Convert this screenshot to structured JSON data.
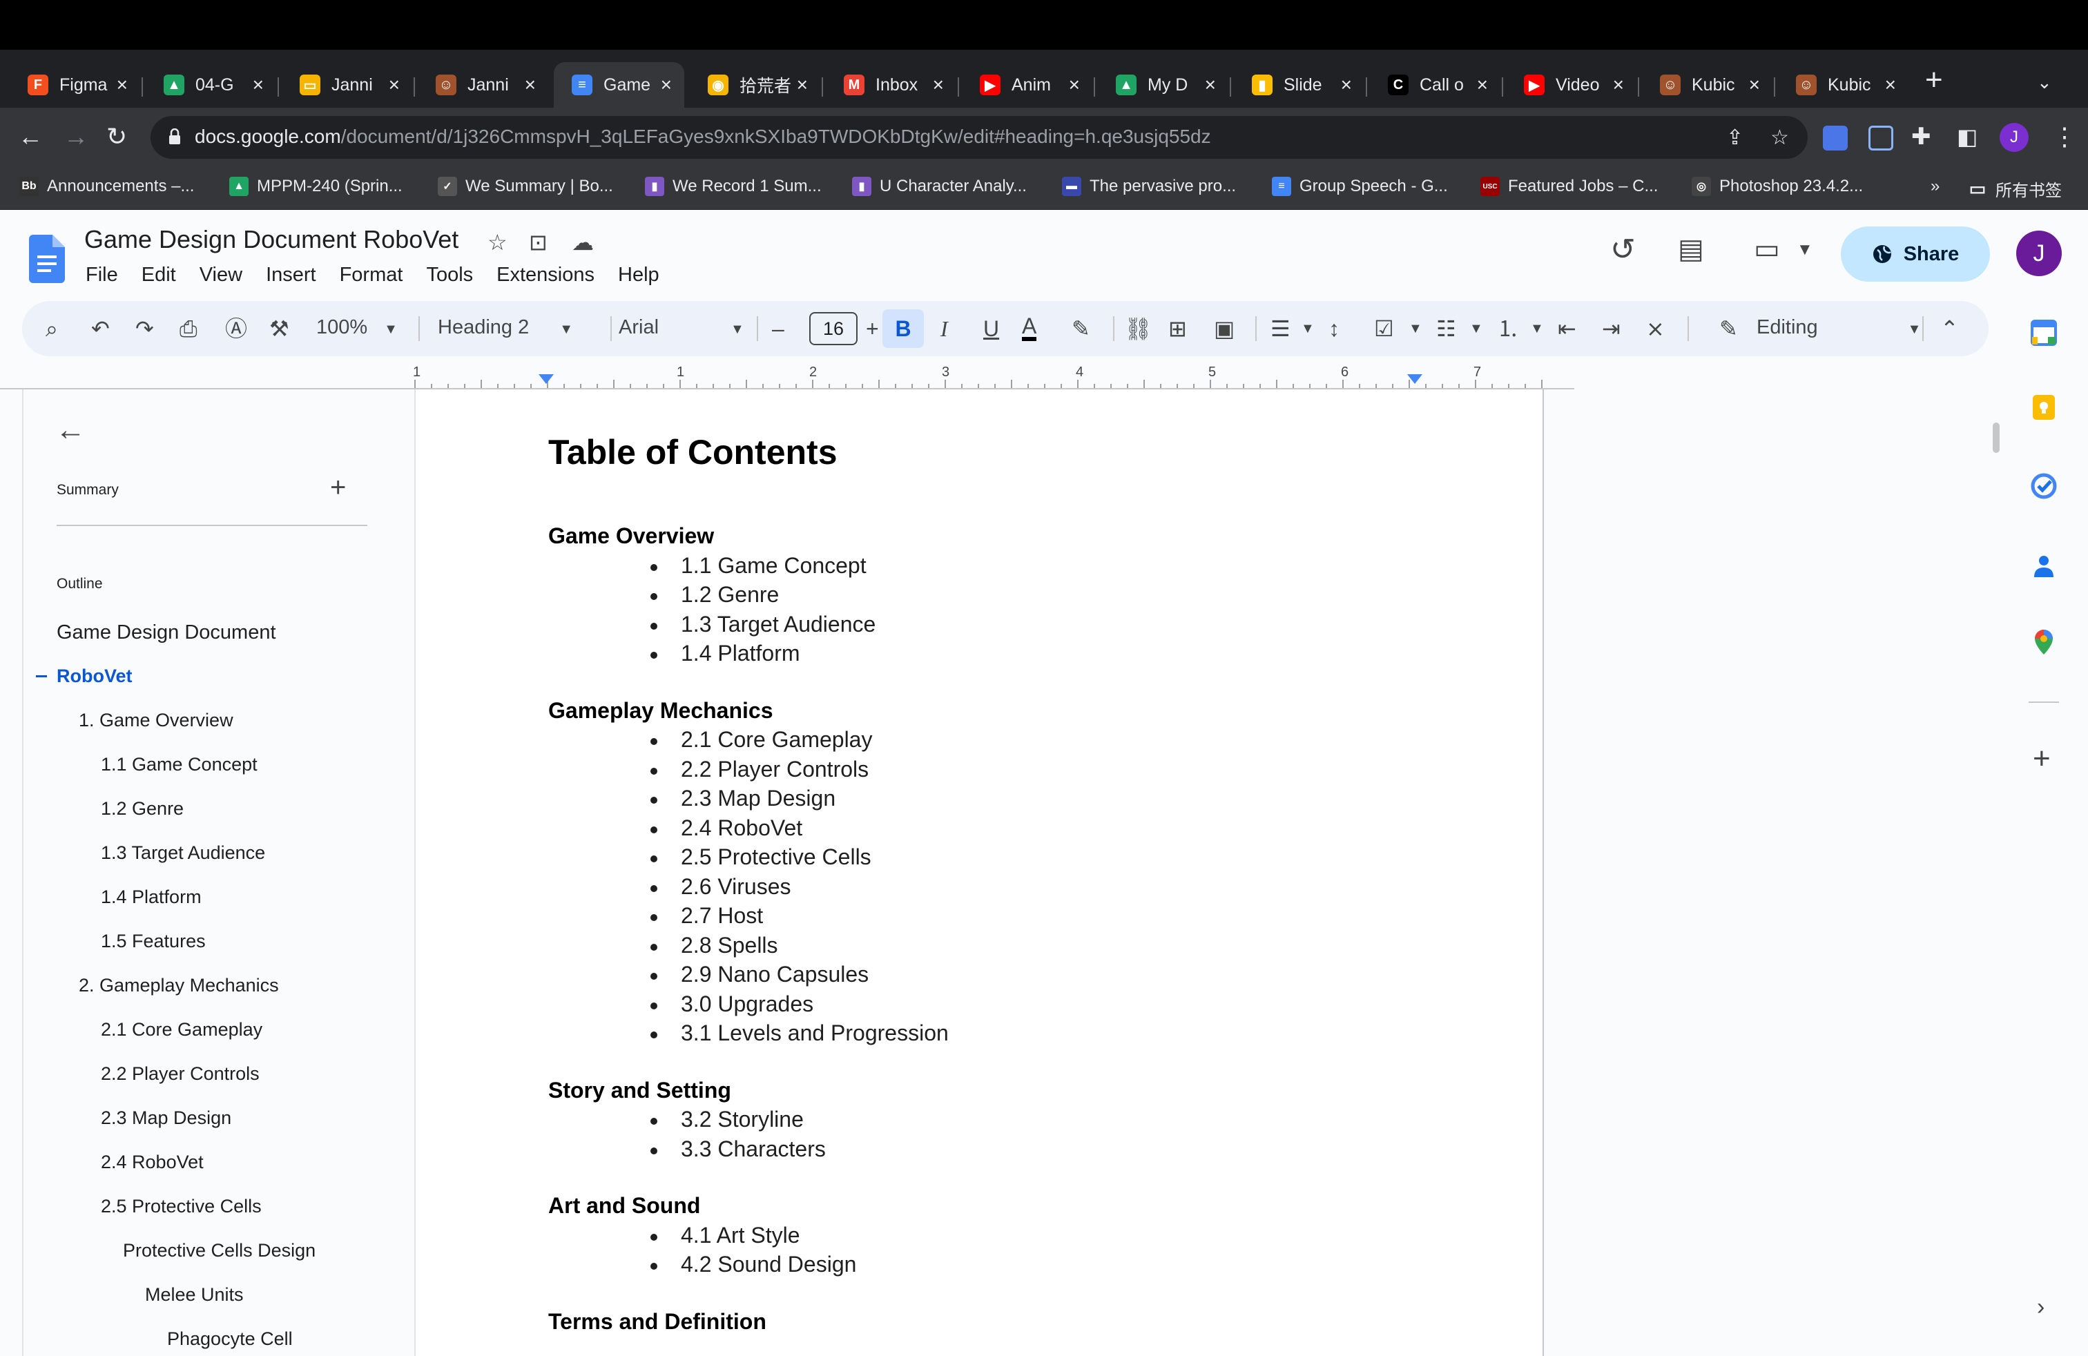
{
  "browser": {
    "tabs": [
      {
        "title": "Figma",
        "favicon": "figma-icon",
        "color": "#f24e1e",
        "glyph": "F"
      },
      {
        "title": "04-G",
        "favicon": "drive-icon",
        "color": "#1fa463",
        "glyph": "▲"
      },
      {
        "title": "Janni",
        "favicon": "slides-icon",
        "color": "#f4b400",
        "glyph": "▭"
      },
      {
        "title": "Janni",
        "favicon": "avatar-icon",
        "color": "#a0522d",
        "glyph": "☺"
      },
      {
        "title": "Game",
        "favicon": "docs-icon",
        "color": "#4285f4",
        "glyph": "≡"
      },
      {
        "title": "拾荒者",
        "favicon": "coin-icon",
        "color": "#f4b400",
        "glyph": "◉"
      },
      {
        "title": "Inbox",
        "favicon": "gmail-icon",
        "color": "#ea4335",
        "glyph": "M"
      },
      {
        "title": "Anim",
        "favicon": "youtube-icon",
        "color": "#ff0000",
        "glyph": "▶"
      },
      {
        "title": "My D",
        "favicon": "drive-icon",
        "color": "#1fa463",
        "glyph": "▲"
      },
      {
        "title": "Slide",
        "favicon": "chart-icon",
        "color": "#fbbc04",
        "glyph": "▮"
      },
      {
        "title": "Call o",
        "favicon": "c-icon",
        "color": "#000000",
        "glyph": "C"
      },
      {
        "title": "Video",
        "favicon": "youtube-icon",
        "color": "#ff0000",
        "glyph": "▶"
      },
      {
        "title": "Kubic",
        "favicon": "avatar-icon",
        "color": "#a0522d",
        "glyph": "☺"
      },
      {
        "title": "Kubic",
        "favicon": "avatar-icon",
        "color": "#a0522d",
        "glyph": "☺"
      }
    ],
    "active_tab_index": 4,
    "url_host": "docs.google.com",
    "url_path": "/document/d/1j326CmmspvH_3qLEFaGyes9xnkSXIba9TWDOKbDtgKw/edit#heading=h.qe3usjq55dz",
    "profile_initial": "J",
    "bookmarks": [
      {
        "label": "Announcements –...",
        "icon": "Bb",
        "color": "#333333"
      },
      {
        "label": "MPPM-240 (Sprin...",
        "icon": "▲",
        "color": "#1fa463"
      },
      {
        "label": "We Summary | Bo...",
        "icon": "✓",
        "color": "#555555"
      },
      {
        "label": "We Record 1 Sum...",
        "icon": "▮",
        "color": "#7e57c2"
      },
      {
        "label": "U Character Analy...",
        "icon": "▮",
        "color": "#7e57c2"
      },
      {
        "label": "The pervasive pro...",
        "icon": "▬",
        "color": "#3949ab"
      },
      {
        "label": "Group Speech - G...",
        "icon": "≡",
        "color": "#4285f4"
      },
      {
        "label": "Featured Jobs – C...",
        "icon": "USC",
        "color": "#990000"
      },
      {
        "label": "Photoshop 23.4.2...",
        "icon": "◎",
        "color": "#444444"
      }
    ],
    "bookmarks_more": "»",
    "all_bookmarks": "所有书签"
  },
  "docs": {
    "title": "Game Design Document RoboVet",
    "menu": [
      "File",
      "Edit",
      "View",
      "Insert",
      "Format",
      "Tools",
      "Extensions",
      "Help"
    ],
    "share_label": "Share",
    "account_initial": "J",
    "toolbar": {
      "zoom": "100%",
      "style": "Heading 2",
      "font": "Arial",
      "font_size": "16",
      "bold": "B",
      "italic": "I",
      "underline": "U",
      "text_color": "A",
      "mode": "Editing"
    },
    "ruler_numbers": [
      "1",
      "1",
      "2",
      "3",
      "4",
      "5",
      "6",
      "7"
    ],
    "accent_color": "#0b57d0"
  },
  "outline": {
    "summary_label": "Summary",
    "outline_label": "Outline",
    "items": [
      {
        "label": "Game Design Document",
        "level": 0
      },
      {
        "label": "RoboVet",
        "level": 0,
        "active": true
      },
      {
        "label": "1. Game Overview",
        "level": 1
      },
      {
        "label": "1.1 Game Concept",
        "level": 2
      },
      {
        "label": "1.2 Genre",
        "level": 2
      },
      {
        "label": "1.3 Target Audience",
        "level": 2
      },
      {
        "label": "1.4 Platform",
        "level": 2
      },
      {
        "label": "1.5 Features",
        "level": 2
      },
      {
        "label": "2. Gameplay Mechanics",
        "level": 1
      },
      {
        "label": "2.1 Core Gameplay",
        "level": 2
      },
      {
        "label": "2.2 Player Controls",
        "level": 2
      },
      {
        "label": "2.3 Map Design",
        "level": 2
      },
      {
        "label": "2.4 RoboVet",
        "level": 2
      },
      {
        "label": "2.5 Protective Cells",
        "level": 2
      },
      {
        "label": "Protective Cells Design",
        "level": 3
      },
      {
        "label": "Melee Units",
        "level": 4
      },
      {
        "label": "Phagocyte Cell",
        "level": 5
      }
    ]
  },
  "document": {
    "heading": "Table of Contents",
    "sections": [
      {
        "title": "Game Overview",
        "items": [
          "1.1 Game Concept",
          "1.2 Genre",
          "1.3 Target Audience",
          "1.4 Platform"
        ]
      },
      {
        "title": "Gameplay Mechanics",
        "items": [
          "2.1 Core Gameplay",
          "2.2 Player Controls",
          "2.3 Map Design",
          "2.4 RoboVet",
          "2.5 Protective Cells",
          "2.6 Viruses",
          "2.7 Host",
          "2.8 Spells",
          "2.9 Nano Capsules",
          "3.0 Upgrades",
          "3.1 Levels and Progression"
        ]
      },
      {
        "title": "Story and Setting",
        "items": [
          "3.2 Storyline",
          "3.3 Characters"
        ]
      },
      {
        "title": "Art and Sound",
        "items": [
          "4.1 Art Style",
          "4.2 Sound Design"
        ]
      },
      {
        "title": "Terms and Definition",
        "items": []
      }
    ]
  }
}
